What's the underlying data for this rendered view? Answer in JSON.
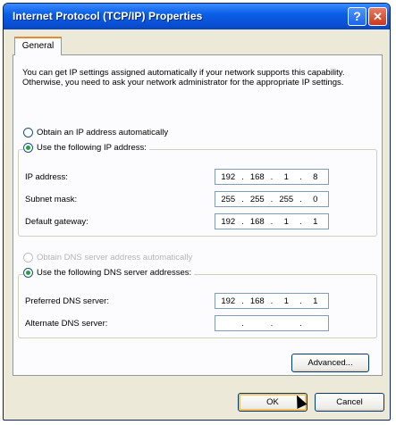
{
  "window": {
    "title": "Internet Protocol (TCP/IP) Properties",
    "help_label": "?",
    "close_label": "✕"
  },
  "tabs": [
    "General"
  ],
  "description": "You can get IP settings assigned automatically if your network supports this capability. Otherwise, you need to ask your network administrator for the appropriate IP settings.",
  "ip": {
    "auto_label": "Obtain an IP address automatically",
    "manual_label": "Use the following IP address:",
    "selected": "manual",
    "fields": [
      {
        "label": "IP address:",
        "octets": [
          "192",
          "168",
          "1",
          "8"
        ]
      },
      {
        "label": "Subnet mask:",
        "octets": [
          "255",
          "255",
          "255",
          "0"
        ]
      },
      {
        "label": "Default gateway:",
        "octets": [
          "192",
          "168",
          "1",
          "1"
        ]
      }
    ]
  },
  "dns": {
    "auto_label": "Obtain DNS server address automatically",
    "manual_label": "Use the following DNS server addresses:",
    "selected": "manual",
    "fields": [
      {
        "label": "Preferred DNS server:",
        "octets": [
          "192",
          "168",
          "1",
          "1"
        ]
      },
      {
        "label": "Alternate DNS server:",
        "octets": [
          "",
          "",
          "",
          ""
        ]
      }
    ]
  },
  "buttons": {
    "advanced": "Advanced...",
    "ok": "OK",
    "cancel": "Cancel"
  }
}
